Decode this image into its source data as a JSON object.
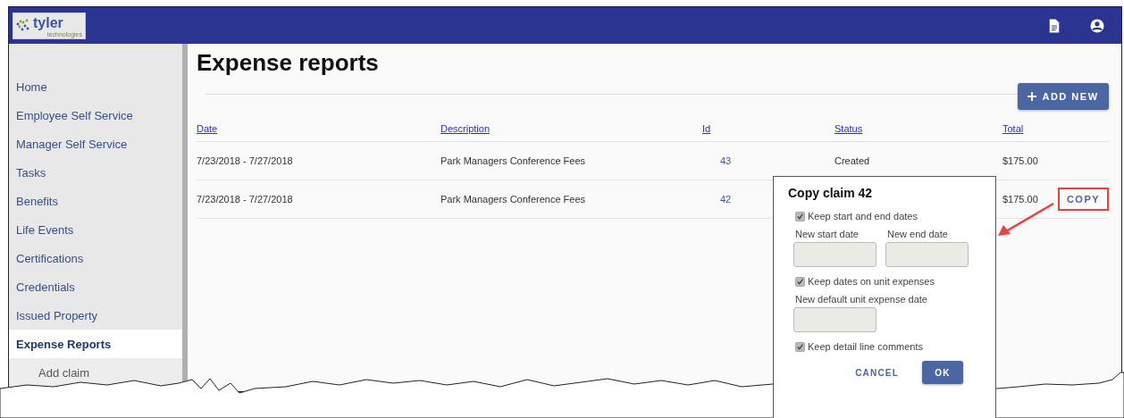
{
  "header": {
    "logo": "tyler",
    "logo_tagline": "technologies"
  },
  "sidebar": {
    "items": [
      {
        "label": "Home",
        "selected": false
      },
      {
        "label": "Employee Self Service",
        "selected": false
      },
      {
        "label": "Manager Self Service",
        "selected": false
      },
      {
        "label": "Tasks",
        "selected": false
      },
      {
        "label": "Benefits",
        "selected": false
      },
      {
        "label": "Life Events",
        "selected": false
      },
      {
        "label": "Certifications",
        "selected": false
      },
      {
        "label": "Credentials",
        "selected": false
      },
      {
        "label": "Issued Property",
        "selected": false
      },
      {
        "label": "Expense Reports",
        "selected": true,
        "children": [
          {
            "label": "Add claim",
            "selected": false
          }
        ]
      }
    ]
  },
  "page": {
    "title": "Expense reports",
    "add_button": "ADD NEW"
  },
  "table": {
    "columns": [
      "Date",
      "Description",
      "Id",
      "Status",
      "Total"
    ],
    "rows": [
      {
        "date": "7/23/2018 - 7/27/2018",
        "description": "Park Managers Conference Fees",
        "id": "43",
        "status": "Created",
        "total": "$175.00"
      },
      {
        "date": "7/23/2018 - 7/27/2018",
        "description": "Park Managers Conference Fees",
        "id": "42",
        "total": "$175.00",
        "action": "COPY"
      }
    ]
  },
  "dialog": {
    "title": "Copy claim 42",
    "items": [
      {
        "kind": "checkbox",
        "label": "Keep start and end dates",
        "checked": true
      },
      {
        "kind": "fields",
        "fields": [
          {
            "label": "New start date"
          },
          {
            "label": "New end date"
          }
        ]
      },
      {
        "kind": "checkbox",
        "label": "Keep dates on unit expenses",
        "checked": true
      },
      {
        "kind": "fields",
        "fields": [
          {
            "label": "New default unit expense date"
          }
        ]
      },
      {
        "kind": "checkbox",
        "label": "Keep detail line comments",
        "checked": true
      }
    ],
    "buttons": [
      {
        "label": "CANCEL",
        "kind": "text"
      },
      {
        "label": "OK",
        "kind": "primary"
      }
    ]
  }
}
